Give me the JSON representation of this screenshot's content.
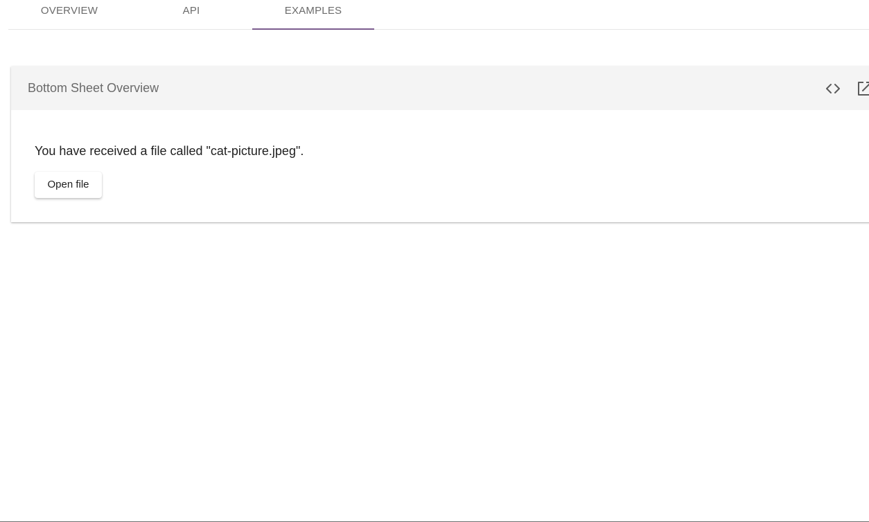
{
  "tabs": [
    {
      "label": "OVERVIEW",
      "active": false
    },
    {
      "label": "API",
      "active": false
    },
    {
      "label": "EXAMPLES",
      "active": true
    }
  ],
  "colors": {
    "tab_indicator": "#7b5c8e",
    "header_bg": "#f4f4f4"
  },
  "example": {
    "title": "Bottom Sheet Overview",
    "icons": {
      "view_code": "code-icon",
      "open_external": "open-in-new-icon"
    },
    "message": "You have received a file called \"cat-picture.jpeg\".",
    "button_label": "Open file"
  }
}
